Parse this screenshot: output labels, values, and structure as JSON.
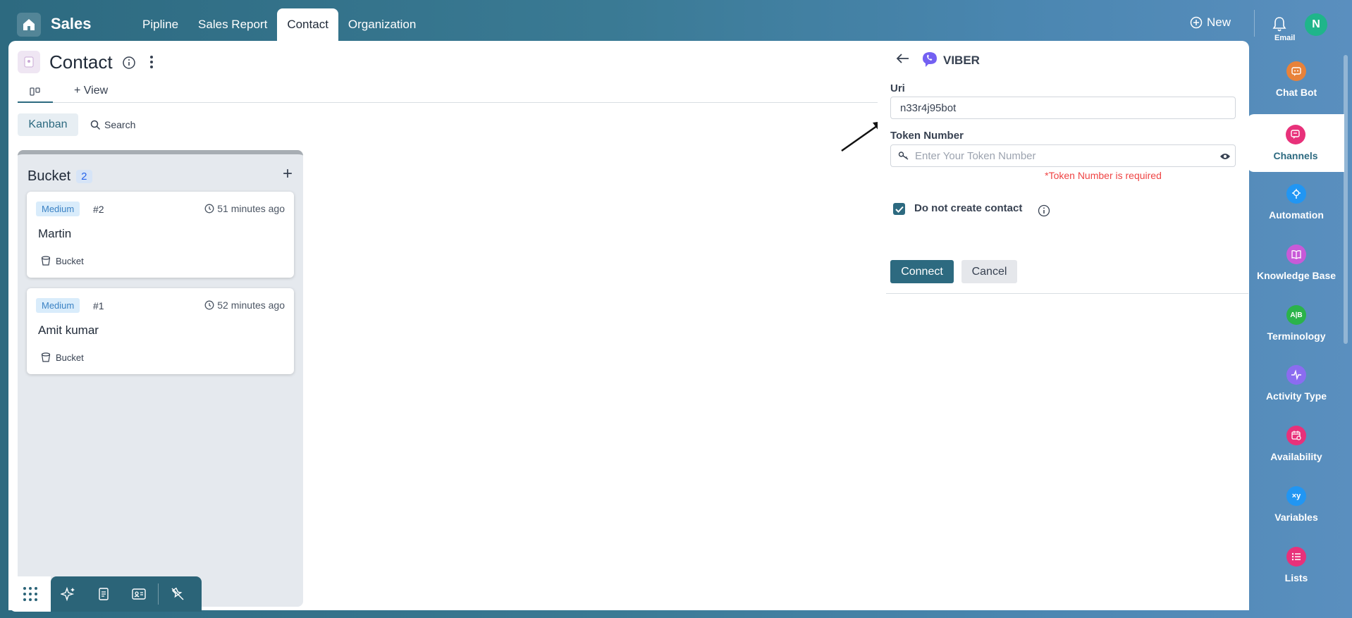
{
  "topbar": {
    "app_title": "Sales",
    "nav": [
      "Pipline",
      "Sales Report",
      "Contact",
      "Organization"
    ],
    "active_nav": "Contact",
    "new_label": "New",
    "avatar_letter": "N"
  },
  "page": {
    "title": "Contact",
    "add_view_label": "View",
    "kanban_label": "Kanban",
    "search_label": "Search"
  },
  "bucket": {
    "name": "Bucket",
    "count": "2",
    "cards": [
      {
        "priority": "Medium",
        "number": "#2",
        "time": "51 minutes ago",
        "name": "Martin",
        "tag": "Bucket"
      },
      {
        "priority": "Medium",
        "number": "#1",
        "time": "52 minutes ago",
        "name": "Amit kumar",
        "tag": "Bucket"
      }
    ]
  },
  "panel": {
    "title": "VIBER",
    "uri_label": "Uri",
    "uri_value": "n33r4j95bot",
    "token_label": "Token Number",
    "token_placeholder": "Enter Your Token Number",
    "token_error": "*Token Number is required",
    "checkbox_label": "Do not create contact",
    "checkbox_checked": true,
    "connect_label": "Connect",
    "cancel_label": "Cancel"
  },
  "rail": {
    "cut_label": "Email",
    "items": [
      {
        "label": "Chat Bot",
        "icon": "chat-bot-icon",
        "color": "#e8823a"
      },
      {
        "label": "Channels",
        "icon": "channels-icon",
        "color": "#e8317a"
      },
      {
        "label": "Automation",
        "icon": "automation-icon",
        "color": "#2196f3"
      },
      {
        "label": "Knowledge Base",
        "icon": "knowledge-base-icon",
        "color": "#c85ad8"
      },
      {
        "label": "Terminology",
        "icon": "terminology-icon",
        "color": "#2bb34a"
      },
      {
        "label": "Activity Type",
        "icon": "activity-type-icon",
        "color": "#8b6cf0"
      },
      {
        "label": "Availability",
        "icon": "availability-icon",
        "color": "#e8317a"
      },
      {
        "label": "Variables",
        "icon": "variables-icon",
        "color": "#2196f3"
      },
      {
        "label": "Lists",
        "icon": "lists-icon",
        "color": "#e8317a"
      }
    ],
    "active": "Channels"
  },
  "colors": {
    "accent": "#2d6a80",
    "error": "#ef4444",
    "viber": "#7360f2"
  }
}
